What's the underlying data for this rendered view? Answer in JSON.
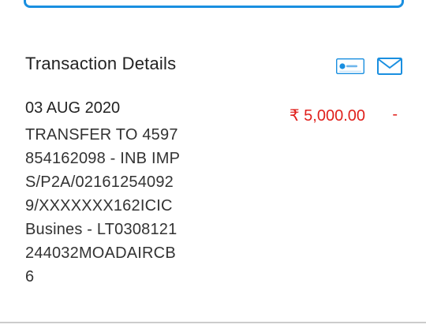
{
  "section": {
    "title": "Transaction Details"
  },
  "icons": {
    "passbook": "passbook-icon",
    "mail": "mail-icon"
  },
  "transaction": {
    "date": "03 AUG 2020",
    "description": "TRANSFER TO 4597854162098 - INB IMPS/P2A/021612540929/XXXXXXX162ICICBusines - LT0308121244032MOADAIRCB6",
    "amount": "₹ 5,000.00",
    "balance": "-"
  },
  "colors": {
    "accent": "#1a8fe0",
    "debit": "#e0201c",
    "divider": "#cccccc"
  }
}
